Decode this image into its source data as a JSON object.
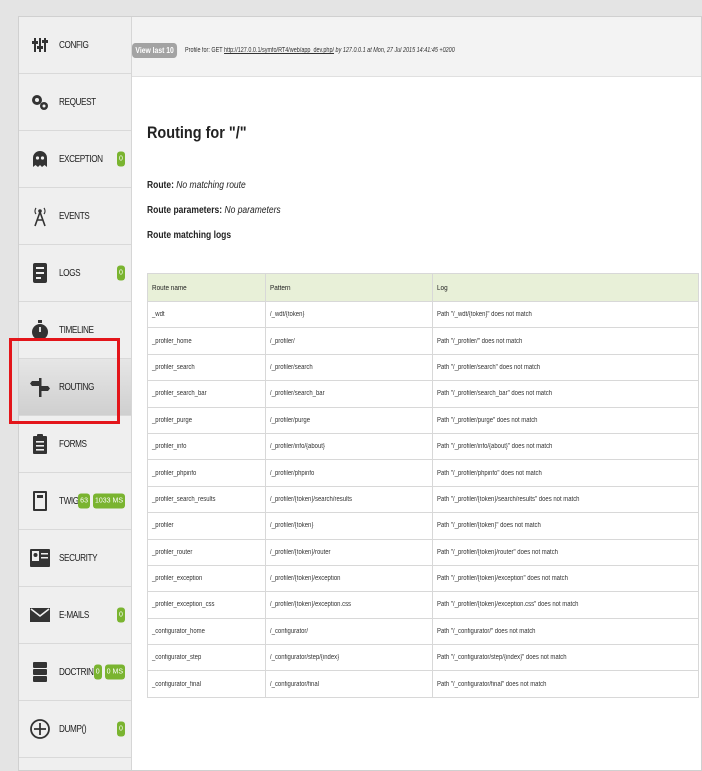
{
  "sidebar": {
    "items": [
      {
        "label": "Config",
        "icon": "config-icon",
        "badges": []
      },
      {
        "label": "Request",
        "icon": "request-gears-icon",
        "badges": []
      },
      {
        "label": "Exception",
        "icon": "exception-ghost-icon",
        "badges": [
          "0"
        ]
      },
      {
        "label": "Events",
        "icon": "events-antenna-icon",
        "badges": []
      },
      {
        "label": "Logs",
        "icon": "logs-icon",
        "badges": [
          "0"
        ]
      },
      {
        "label": "Timeline",
        "icon": "timeline-stopwatch-icon",
        "badges": []
      },
      {
        "label": "Routing",
        "icon": "routing-signpost-icon",
        "badges": [],
        "selected": true
      },
      {
        "label": "Forms",
        "icon": "forms-clipboard-icon",
        "badges": []
      },
      {
        "label": "Twig",
        "icon": "twig-icon",
        "badges": [
          "63",
          "1033 MS"
        ]
      },
      {
        "label": "Security",
        "icon": "security-badge-icon",
        "badges": []
      },
      {
        "label": "E-Mails",
        "icon": "email-envelope-icon",
        "badges": [
          "0"
        ]
      },
      {
        "label": "Doctrine",
        "icon": "doctrine-database-icon",
        "badges": [
          "0",
          "0 MS"
        ]
      },
      {
        "label": "Dump()",
        "icon": "dump-crosshair-icon",
        "badges": [
          "0"
        ]
      }
    ]
  },
  "header": {
    "view_last": "View last 10",
    "profile_prefix": "Profile for: GET",
    "profile_url": "http://127.0.0.1/symfo/RT4/web/app_dev.php/",
    "profile_by": "by",
    "profile_ip": "127.0.0.1",
    "profile_at": "at",
    "profile_date": "Mon, 27 Jul 2015 14:41:45 +0200"
  },
  "main": {
    "title": "Routing for \"/\"",
    "route_label": "Route:",
    "route_value": "No matching route",
    "params_label": "Route parameters:",
    "params_value": "No parameters",
    "logs_heading": "Route matching logs",
    "table": {
      "headers": [
        "Route name",
        "Pattern",
        "Log"
      ],
      "rows": [
        [
          "_wdt",
          "/_wdt/{token}",
          "Path \"/_wdt/{token}\" does not match"
        ],
        [
          "_profiler_home",
          "/_profiler/",
          "Path \"/_profiler/\" does not match"
        ],
        [
          "_profiler_search",
          "/_profiler/search",
          "Path \"/_profiler/search\" does not match"
        ],
        [
          "_profiler_search_bar",
          "/_profiler/search_bar",
          "Path \"/_profiler/search_bar\" does not match"
        ],
        [
          "_profiler_purge",
          "/_profiler/purge",
          "Path \"/_profiler/purge\" does not match"
        ],
        [
          "_profiler_info",
          "/_profiler/info/{about}",
          "Path \"/_profiler/info/{about}\" does not match"
        ],
        [
          "_profiler_phpinfo",
          "/_profiler/phpinfo",
          "Path \"/_profiler/phpinfo\" does not match"
        ],
        [
          "_profiler_search_results",
          "/_profiler/{token}/search/results",
          "Path \"/_profiler/{token}/search/results\" does not match"
        ],
        [
          "_profiler",
          "/_profiler/{token}",
          "Path \"/_profiler/{token}\" does not match"
        ],
        [
          "_profiler_router",
          "/_profiler/{token}/router",
          "Path \"/_profiler/{token}/router\" does not match"
        ],
        [
          "_profiler_exception",
          "/_profiler/{token}/exception",
          "Path \"/_profiler/{token}/exception\" does not match"
        ],
        [
          "_profiler_exception_css",
          "/_profiler/{token}/exception.css",
          "Path \"/_profiler/{token}/exception.css\" does not match"
        ],
        [
          "_configurator_home",
          "/_configurator/",
          "Path \"/_configurator/\" does not match"
        ],
        [
          "_configurator_step",
          "/_configurator/step/{index}",
          "Path \"/_configurator/step/{index}\" does not match"
        ],
        [
          "_configurator_final",
          "/_configurator/final",
          "Path \"/_configurator/final\" does not match"
        ]
      ]
    }
  },
  "colors": {
    "badge": "#7ab430",
    "table_header": "#e8f0d8",
    "highlight": "#e3151a"
  }
}
